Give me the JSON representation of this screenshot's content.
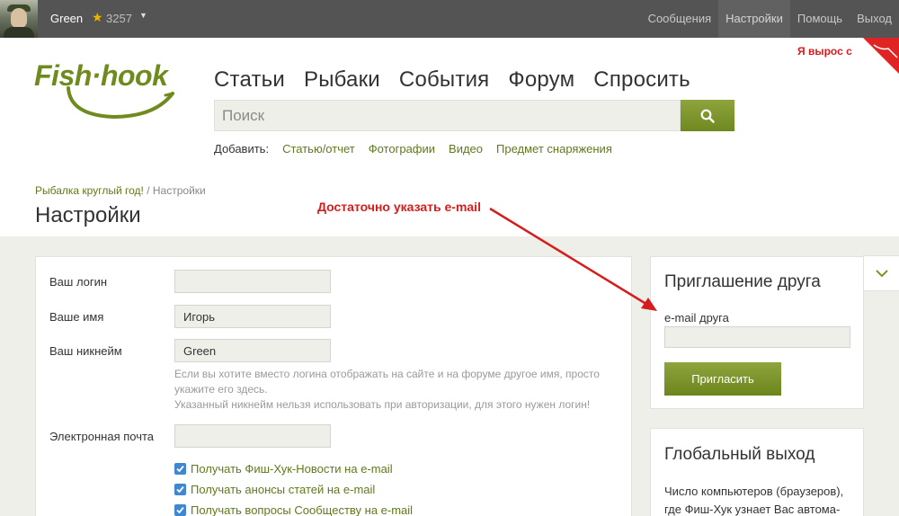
{
  "topbar": {
    "username": "Green",
    "rating": "3257",
    "nav": [
      {
        "label": "Сообщения"
      },
      {
        "label": "Настройки"
      },
      {
        "label": "Помощь"
      },
      {
        "label": "Выход"
      }
    ]
  },
  "logo": {
    "text": "Fish·hook"
  },
  "main_nav": [
    {
      "label": "Статьи"
    },
    {
      "label": "Рыбаки"
    },
    {
      "label": "События"
    },
    {
      "label": "Форум"
    },
    {
      "label": "Спросить"
    }
  ],
  "search": {
    "placeholder": "Поиск"
  },
  "add_row": {
    "label": "Добавить:",
    "links": [
      {
        "label": "Статью/отчет"
      },
      {
        "label": "Фотографии"
      },
      {
        "label": "Видео"
      },
      {
        "label": "Предмет снаряжения"
      }
    ]
  },
  "promo": {
    "text": "Я вырос с"
  },
  "breadcrumb": {
    "home": "Рыбалка круглый год!",
    "separator": "/",
    "current": "Настройки"
  },
  "page": {
    "title": "Настройки"
  },
  "annotation": {
    "text": "Достаточно указать e-mail"
  },
  "settings": {
    "login": {
      "label": "Ваш логин",
      "value": ""
    },
    "name": {
      "label": "Ваше имя",
      "value": "Игорь"
    },
    "nickname": {
      "label": "Ваш никнейм",
      "value": "Green",
      "hint_line1": "Если вы хотите вместо логина отображать на сайте и на форуме другое имя, просто",
      "hint_line2": "укажите его здесь.",
      "hint_line3": "Указанный никнейм нельзя использовать при авторизации, для этого нужен логин!"
    },
    "email": {
      "label": "Электронная почта",
      "value": ""
    },
    "checkboxes": [
      {
        "label": "Получать Фиш-Хук-Новости на e-mail",
        "checked": true
      },
      {
        "label": "Получать анонсы статей на e-mail",
        "checked": true
      },
      {
        "label": "Получать вопросы Сообществу на e-mail",
        "checked": true
      }
    ]
  },
  "invite": {
    "title": "Приглашение друга",
    "label": "e-mail друга",
    "button": "Пригласить"
  },
  "logout": {
    "title": "Глобальный выход",
    "text_line1": "Число компьютеров (браузеров),",
    "text_line2": "где Фиш-Хук узнает Вас автома-"
  },
  "colors": {
    "accent_green": "#6f8a1d",
    "annotation_red": "#d61d1d",
    "topbar": "#545454",
    "checkbox_blue": "#3f87d3"
  }
}
